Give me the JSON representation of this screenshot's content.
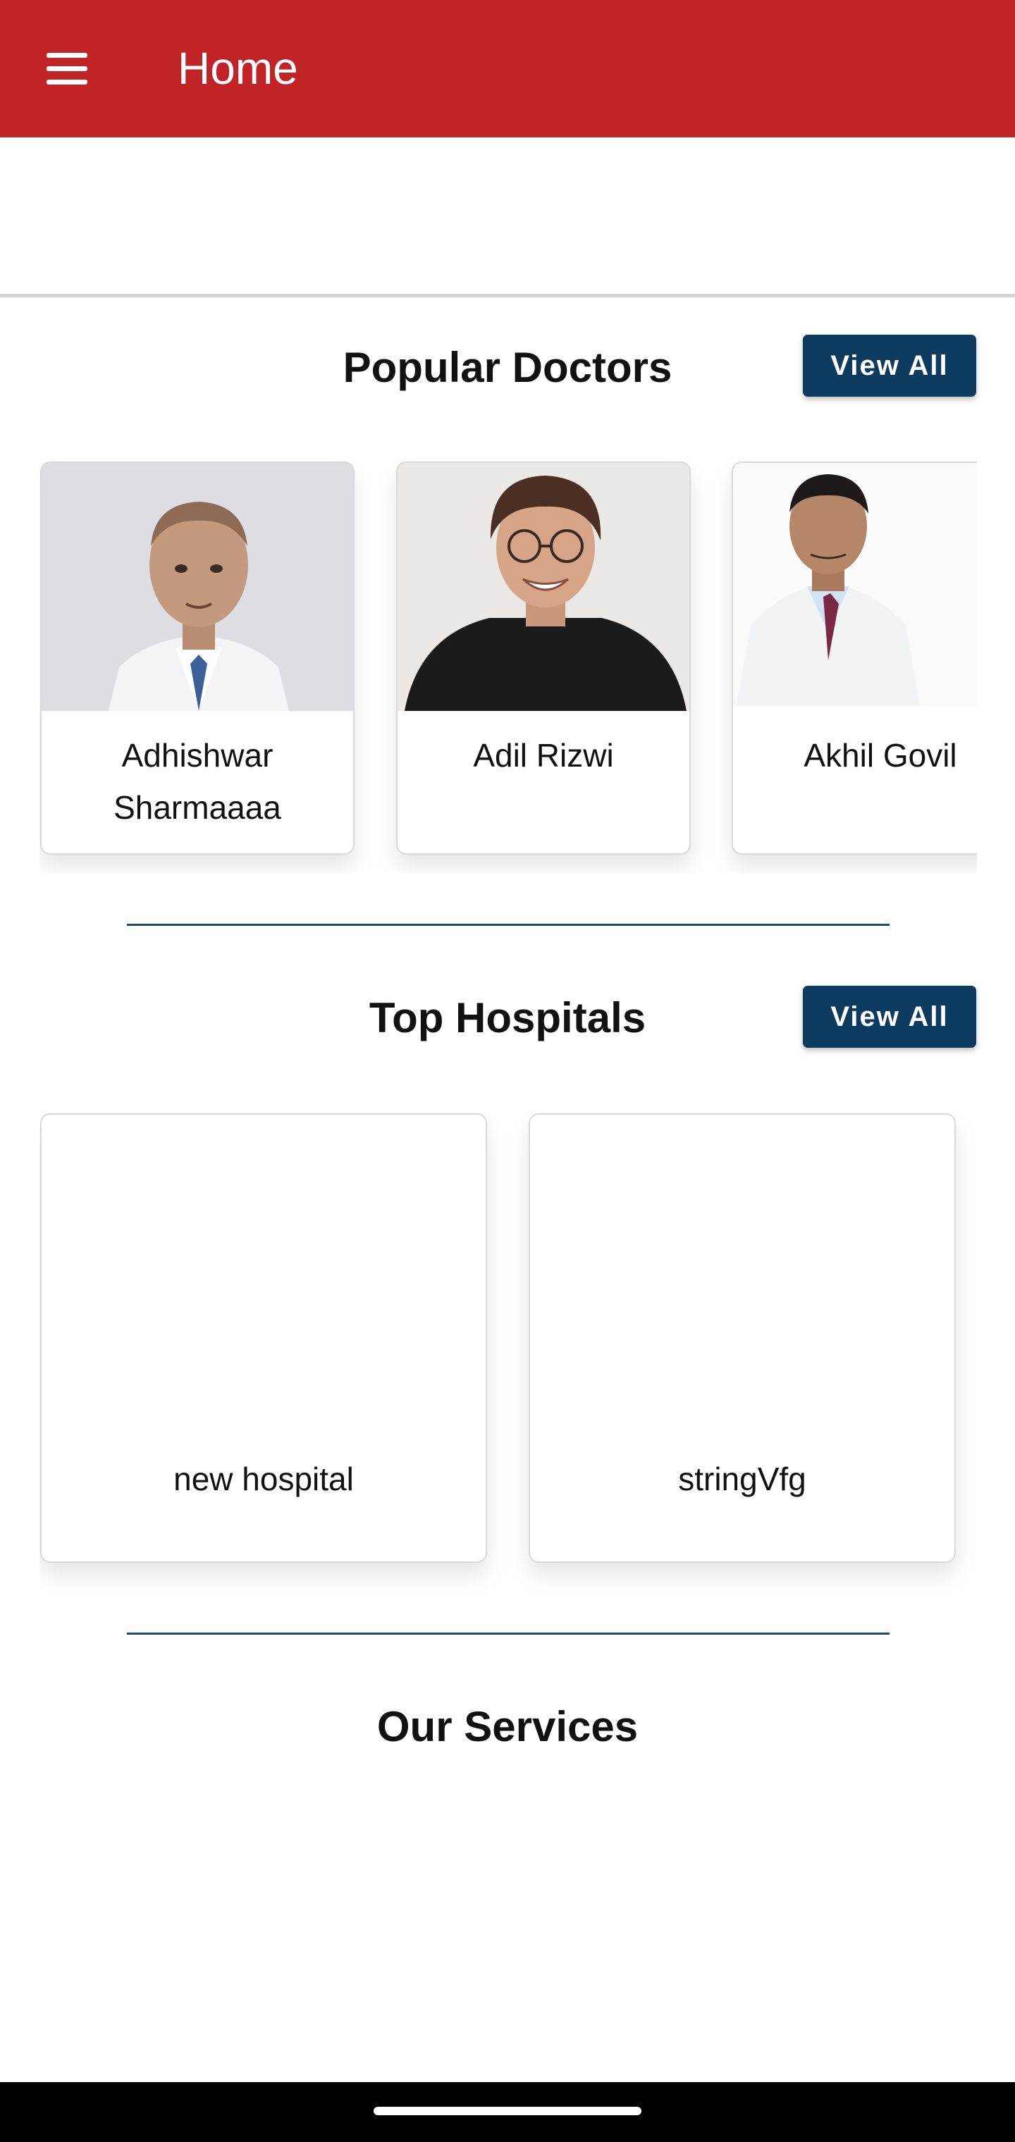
{
  "app_bar": {
    "title": "Home",
    "menu_icon": "hamburger-menu-icon",
    "color": "#c12426"
  },
  "popular_doctors": {
    "title": "Popular Doctors",
    "view_all_label": "View All",
    "doctors": [
      {
        "name": "Adhishwar Sharmaaaa"
      },
      {
        "name": "Adil Rizwi"
      },
      {
        "name": "Akhil Govil"
      }
    ]
  },
  "top_hospitals": {
    "title": "Top Hospitals",
    "view_all_label": "View All",
    "hospitals": [
      {
        "name": "new hospital"
      },
      {
        "name": "stringVfg"
      }
    ]
  },
  "our_services": {
    "title": "Our Services"
  },
  "colors": {
    "accent": "#0d3a5f",
    "divider": "#1f4a6e"
  }
}
